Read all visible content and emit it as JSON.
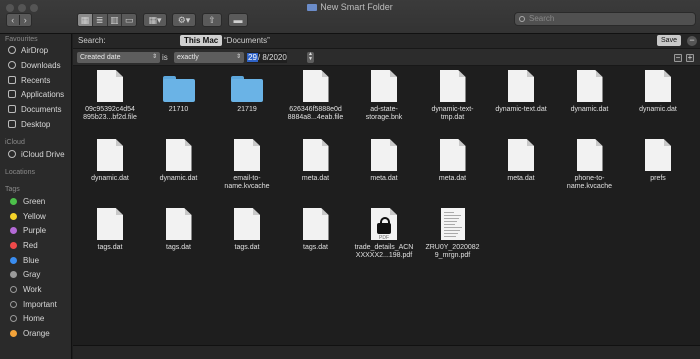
{
  "window": {
    "title": "New Smart Folder"
  },
  "toolbar": {
    "back_icon": "chevron-left-icon",
    "forward_icon": "chevron-right-icon",
    "view_modes": [
      "icon-view",
      "list-view",
      "column-view",
      "gallery-view"
    ],
    "active_view": "icon-view",
    "search_placeholder": "Search"
  },
  "sidebar": {
    "sections": {
      "favourites": "Favourites",
      "icloud": "iCloud",
      "locations": "Locations",
      "tags": "Tags"
    },
    "favourites": [
      {
        "label": "AirDrop",
        "icon": "airdrop-icon"
      },
      {
        "label": "Downloads",
        "icon": "downloads-icon"
      },
      {
        "label": "Recents",
        "icon": "recents-icon"
      },
      {
        "label": "Applications",
        "icon": "applications-icon"
      },
      {
        "label": "Documents",
        "icon": "documents-icon"
      },
      {
        "label": "Desktop",
        "icon": "desktop-icon"
      }
    ],
    "icloud": [
      {
        "label": "iCloud Drive",
        "icon": "cloud-icon"
      }
    ],
    "tags": [
      {
        "label": "Green",
        "color": "#4cc04a"
      },
      {
        "label": "Yellow",
        "color": "#f5d329"
      },
      {
        "label": "Purple",
        "color": "#b46ad6"
      },
      {
        "label": "Red",
        "color": "#ef4a4a"
      },
      {
        "label": "Blue",
        "color": "#3a8df0"
      },
      {
        "label": "Gray",
        "color": "#9a9a9a"
      },
      {
        "label": "Work",
        "color": "#2a2a2a"
      },
      {
        "label": "Important",
        "color": "#2a2a2a"
      },
      {
        "label": "Home",
        "color": "#2a2a2a"
      },
      {
        "label": "Orange",
        "color": "#f3a33a"
      }
    ]
  },
  "scope_bar": {
    "label": "Search:",
    "this_mac": "This Mac",
    "documents": "“Documents”",
    "save": "Save",
    "remove": "−"
  },
  "criteria": {
    "attribute": "Created date",
    "is": "is",
    "operator": "exactly",
    "day": "29",
    "rest_of_date": "/  8/2020",
    "remove": "−",
    "add": "+"
  },
  "files": [
    {
      "name": "09c95392c4d54\n895b23...bf2d.file",
      "kind": "doc"
    },
    {
      "name": "21710",
      "kind": "folder"
    },
    {
      "name": "21719",
      "kind": "folder"
    },
    {
      "name": "626346f5888e0d\n8884a8...4eab.file",
      "kind": "doc"
    },
    {
      "name": "ad-state-\nstorage.bnk",
      "kind": "doc"
    },
    {
      "name": "dynamic-text-\ntmp.dat",
      "kind": "doc"
    },
    {
      "name": "dynamic-text.dat",
      "kind": "doc"
    },
    {
      "name": "dynamic.dat",
      "kind": "doc"
    },
    {
      "name": "dynamic.dat",
      "kind": "doc"
    },
    {
      "name": "dynamic.dat",
      "kind": "doc"
    },
    {
      "name": "dynamic.dat",
      "kind": "doc"
    },
    {
      "name": "email-to-\nname.kvcache",
      "kind": "doc"
    },
    {
      "name": "meta.dat",
      "kind": "doc"
    },
    {
      "name": "meta.dat",
      "kind": "doc"
    },
    {
      "name": "meta.dat",
      "kind": "doc"
    },
    {
      "name": "meta.dat",
      "kind": "doc"
    },
    {
      "name": "phone-to-\nname.kvcache",
      "kind": "doc"
    },
    {
      "name": "prefs",
      "kind": "doc"
    },
    {
      "name": "tags.dat",
      "kind": "doc"
    },
    {
      "name": "tags.dat",
      "kind": "doc"
    },
    {
      "name": "tags.dat",
      "kind": "doc"
    },
    {
      "name": "tags.dat",
      "kind": "doc"
    },
    {
      "name": "trade_details_ACN\nXXXXX2...198.pdf",
      "kind": "locked-pdf",
      "badge": "PDF"
    },
    {
      "name": "ZRU0Y_2020082\n9_mrgn.pdf",
      "kind": "pdf-thumb"
    }
  ]
}
